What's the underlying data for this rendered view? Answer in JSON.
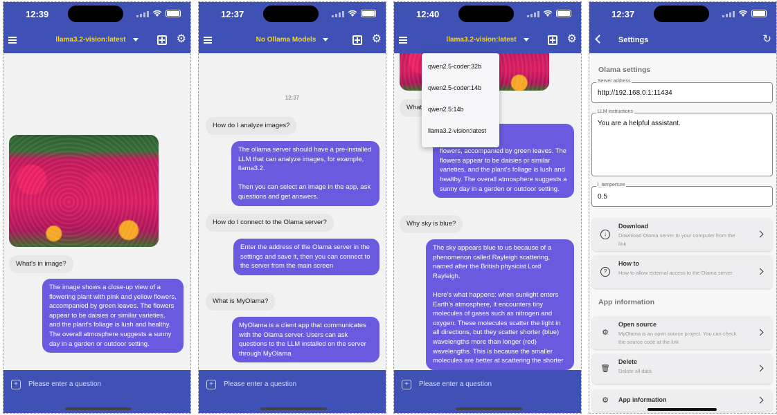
{
  "screens": [
    {
      "time": "12:39",
      "model": "llama3.2-vision:latest",
      "messages": {
        "q1": "What's in image?",
        "a1": "The image shows a close-up view of a flowering plant with pink and yellow flowers, accompanied by green leaves. The flowers appear to be daisies or similar varieties, and the plant's foliage is lush and healthy. The overall atmosphere suggests a sunny day in a garden or outdoor setting."
      },
      "input_placeholder": "Please enter a question"
    },
    {
      "time": "12:37",
      "model": "No Ollama Models",
      "timestamp": "12:37",
      "messages": {
        "q1": "How do I analyze images?",
        "a1": "The ollama server should have a pre-installed LLM that can analyze images, for example, llama3.2.\n\nThen you can select an image in the app, ask questions and get answers.",
        "q2": "How do I connect to the Olama server?",
        "a2": "Enter the address of the Olama server in the settings and save it, then you can connect to the server from the main screen",
        "q3": "What is MyOlama?",
        "a3": "MyOlama is a client app that communicates with the Olama server. Users can ask questions to the LLM installed on the server through MyOlama"
      },
      "input_placeholder": "Please enter a question"
    },
    {
      "time": "12:40",
      "model": "llama3.2-vision:latest",
      "dropdown": [
        "qwen2.5-coder:32b",
        "qwen2.5-coder:14b",
        "qwen2.5:14b",
        "llama3.2-vision:latest"
      ],
      "messages": {
        "q1_partial": "What",
        "a1": "The image shows a close-up view of a flowering plant with pink and yellow flowers, accompanied by green leaves. The flowers appear to be daisies or similar varieties, and the plant's foliage is lush and healthy. The overall atmosphere suggests a sunny day in a garden or outdoor setting.",
        "a1_visible": "a close-up view of\nh pink and yellow\nflowers, accompanied by green leaves. The flowers appear to be daisies or similar varieties, and the plant's foliage is lush and healthy. The overall atmosphere suggests a sunny day in a garden or outdoor setting.",
        "q2": "Why sky is blue?",
        "a2": "The sky appears blue to us because of a phenomenon called Rayleigh scattering, named after the British physicist Lord Rayleigh.\n\nHere's what happens: when sunlight enters Earth's atmosphere, it encounters tiny molecules of gases such as nitrogen and oxygen. These molecules scatter the light in all directions, but they scatter shorter (blue) wavelengths more than longer (red) wavelengths. This is because the smaller molecules are better at scattering the shorter"
      },
      "input_placeholder": "Please enter a question"
    },
    {
      "time": "12:37",
      "title": "Settings",
      "olama_section": "Olama settings",
      "server_label": "Server address",
      "server_value": "http://192.168.0.1:11434",
      "instructions_label": "LLM instructions",
      "instructions_value": "You are a helpful assistant.",
      "temp_label": "l_temperture",
      "temp_value": "0.5",
      "app_section": "App information",
      "cards": [
        {
          "title": "Download",
          "sub": "Download Olama server to your computer from the link"
        },
        {
          "title": "How to",
          "sub": "How to allow external access to the Olama server"
        },
        {
          "title": "Open source",
          "sub": "MyOlama is an open source project. You can check the source code at the link"
        },
        {
          "title": "Delete",
          "sub": "Delete all data"
        },
        {
          "title": "App information",
          "sub": ""
        }
      ]
    }
  ],
  "colors": {
    "appbar": "#3f51b5",
    "bot_bubble": "#6a5ae0",
    "model_title": "#ffd600"
  },
  "icons": [
    "menu-icon",
    "new-chat-icon",
    "gear-icon",
    "back-icon",
    "refresh-icon",
    "download-icon",
    "help-icon",
    "chip-icon",
    "trash-icon",
    "settings-icon",
    "add-image-icon"
  ]
}
